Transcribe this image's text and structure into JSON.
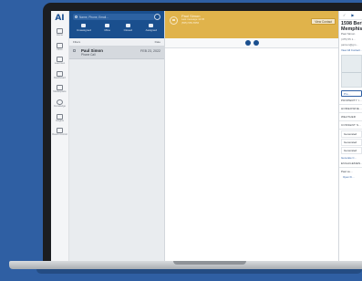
{
  "nav": {
    "logo": "AI",
    "items": [
      {
        "label": "Home",
        "icon": "home-icon"
      },
      {
        "label": "Inbox",
        "icon": "inbox-icon"
      },
      {
        "label": "Lead Gen",
        "icon": "leadgen-icon"
      },
      {
        "label": "Dashboard",
        "icon": "dashboard-icon"
      },
      {
        "label": "Marketplace",
        "icon": "marketplace-icon"
      },
      {
        "label": "Knowledge",
        "icon": "knowledge-icon"
      },
      {
        "label": "Insights",
        "icon": "insights-icon"
      },
      {
        "label": "Reach Control",
        "icon": "reach-icon"
      }
    ]
  },
  "inbox": {
    "search_placeholder": "Name, Phone, Email...",
    "filters": [
      {
        "label": "Unassigned"
      },
      {
        "label": "Mine"
      },
      {
        "label": "Closed"
      },
      {
        "label": "Assigned"
      }
    ],
    "filters_label": "Filters",
    "sort_label": "Date",
    "conversations": [
      {
        "name": "Paul Simon",
        "subtitle": "Phone Call",
        "date": "FEB 23, 2022"
      }
    ]
  },
  "conversation": {
    "name": "Paul Simon",
    "sub1": "Last message 12:05",
    "sub2": "(555) 555-5555",
    "view_contact_label": "View Contact"
  },
  "contact": {
    "address_line1": "1598 Berk",
    "address_line2": "Memphis,",
    "owner": "Paul Simon",
    "phone": "(475) 55 1…",
    "email": "paimon@gm…",
    "view_all": "View All Contact…",
    "pro_button": "Pro…",
    "sections": [
      "PROPERTY I…",
      "HOMEOWNE…",
      "WEATHER",
      "CONSENT S…"
    ],
    "generated": [
      "Generated",
      "Generated",
      "Generated"
    ],
    "generate_link": "Generate C…",
    "engagement_label": "ENGAGEMEN…",
    "engagement_item": "Paul su…",
    "engagement_link": "Open Fi…"
  }
}
